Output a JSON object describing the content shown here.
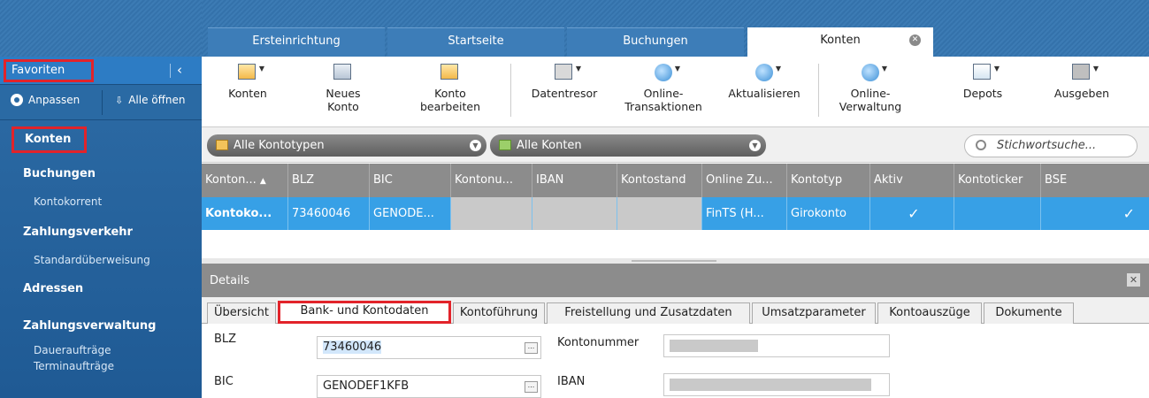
{
  "sidebar": {
    "favorites_label": "Favoriten",
    "collapse_icon": "‹",
    "customize_label": "Anpassen",
    "open_all_label": "Alle öffnen",
    "items": [
      {
        "label": "Konten",
        "type": "head"
      },
      {
        "label": "Buchungen",
        "type": "head"
      },
      {
        "label": "Kontokorrent",
        "type": "sub"
      },
      {
        "label": "Zahlungsverkehr",
        "type": "head"
      },
      {
        "label": "Standardüberweisung",
        "type": "sub"
      },
      {
        "label": "Adressen",
        "type": "head"
      },
      {
        "label": "Zahlungsverwaltung",
        "type": "head"
      },
      {
        "label": "Daueraufträge",
        "type": "sub"
      },
      {
        "label": "Terminaufträge",
        "type": "sub"
      }
    ]
  },
  "tabs": [
    {
      "label": "Ersteinrichtung"
    },
    {
      "label": "Startseite"
    },
    {
      "label": "Buchungen"
    },
    {
      "label": "Konten",
      "active": true
    }
  ],
  "toolbar": [
    {
      "label1": "Konten",
      "label2": "",
      "icon": "accounts-icon"
    },
    {
      "label1": "Neues",
      "label2": "Konto",
      "icon": "new-account-icon"
    },
    {
      "label1": "Konto",
      "label2": "bearbeiten",
      "icon": "edit-account-icon"
    },
    {
      "label1": "Datentresor",
      "label2": "",
      "icon": "safe-icon"
    },
    {
      "label1": "Online-",
      "label2": "Transaktionen",
      "icon": "online-transactions-icon"
    },
    {
      "label1": "Aktualisieren",
      "label2": "",
      "icon": "refresh-icon"
    },
    {
      "label1": "Online-",
      "label2": "Verwaltung",
      "icon": "online-admin-icon"
    },
    {
      "label1": "Depots",
      "label2": "",
      "icon": "depot-icon"
    },
    {
      "label1": "Ausgeben",
      "label2": "",
      "icon": "print-icon"
    }
  ],
  "filters": {
    "type_filter": "Alle Kontotypen",
    "account_filter": "Alle Konten",
    "search_placeholder": "Stichwortsuche..."
  },
  "table": {
    "columns": [
      "Konton...",
      "BLZ",
      "BIC",
      "Kontonu...",
      "IBAN",
      "Kontostand",
      "Online Zu...",
      "Kontotyp",
      "Aktiv",
      "Kontoticker",
      "BSE"
    ],
    "sort_icon": "▲",
    "row": [
      "Kontoko...",
      "73460046",
      "GENODE...",
      "",
      "",
      "",
      "FinTS (H...",
      "Girokonto",
      "✓",
      "",
      "✓"
    ]
  },
  "details": {
    "title": "Details",
    "close_icon": "✕",
    "tabs": [
      "Übersicht",
      "Bank- und Kontodaten",
      "Kontoführung",
      "Freistellung und Zusatzdaten",
      "Umsatzparameter",
      "Kontoauszüge",
      "Dokumente"
    ],
    "active_tab": "Bank- und Kontodaten",
    "fields": {
      "blz_label": "BLZ",
      "blz_value": "73460046",
      "bic_label": "BIC",
      "bic_value": "GENODEF1KFB",
      "kontonummer_label": "Kontonummer",
      "iban_label": "IBAN",
      "browse_label": "..."
    }
  },
  "colors": {
    "highlight": "#e2232a",
    "sidebar": "#2f6ea8",
    "selected_row": "#37a0e6",
    "header_gray": "#8c8c8c"
  }
}
